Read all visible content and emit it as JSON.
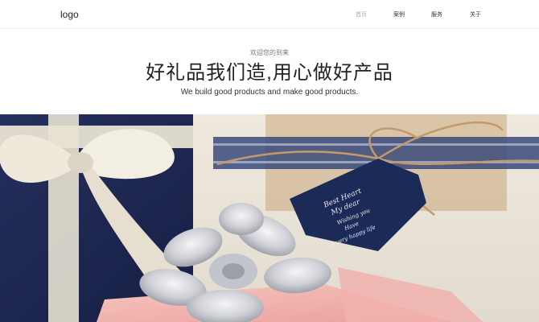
{
  "header": {
    "logo": "logo",
    "nav": [
      {
        "label": "首页",
        "active": true
      },
      {
        "label": "案例",
        "active": false
      },
      {
        "label": "服务",
        "active": false
      },
      {
        "label": "关于",
        "active": false
      }
    ]
  },
  "hero": {
    "welcome": "欢迎您的到来",
    "headline": "好礼品我们造,用心做好产品",
    "subheadline": "We build good products and make good products."
  },
  "banner": {
    "tag_lines": [
      "Best Heart",
      "My dear",
      "Wishing you",
      "Have",
      "a very happy life"
    ]
  },
  "colors": {
    "active_nav": "#b8a48c",
    "navy_box": "#1f2a55",
    "ribbon_cream": "#ece6d6",
    "pink_box": "#f3b8b4"
  }
}
